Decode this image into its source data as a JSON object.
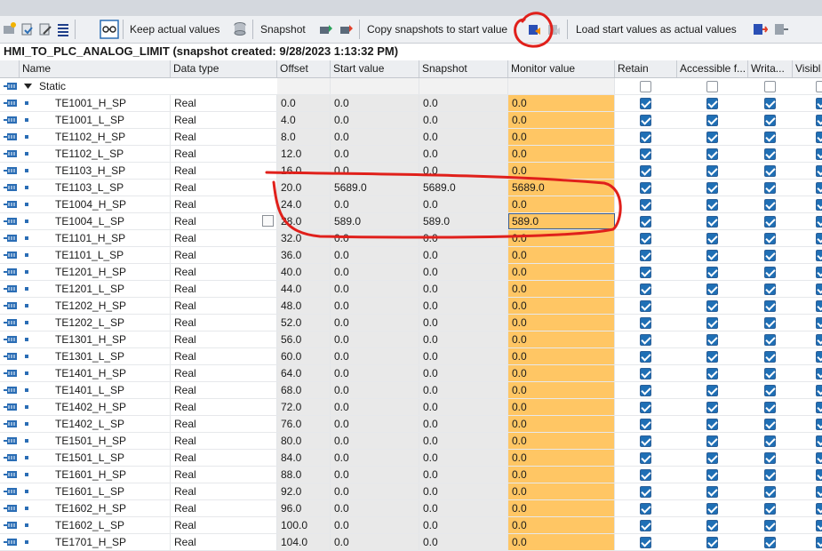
{
  "toolbar": {
    "keep_actual_values": "Keep actual values",
    "snapshot": "Snapshot",
    "copy_snapshots": "Copy snapshots to start value",
    "load_start_values": "Load start values as actual values"
  },
  "block": {
    "title": "HMI_TO_PLC_ANALOG_LIMIT (snapshot created: 9/28/2023 1:13:32 PM)"
  },
  "columns": {
    "name": "Name",
    "data_type": "Data type",
    "offset": "Offset",
    "start_value": "Start value",
    "snapshot": "Snapshot",
    "monitor_value": "Monitor value",
    "retain": "Retain",
    "accessible": "Accessible f...",
    "writable": "Writa...",
    "visible": "Visibl"
  },
  "static_label": "Static",
  "rows": [
    {
      "name": "TE1001_H_SP",
      "type": "Real",
      "offset": "0.0",
      "start": "0.0",
      "snapshot": "0.0",
      "monitor": "0.0"
    },
    {
      "name": "TE1001_L_SP",
      "type": "Real",
      "offset": "4.0",
      "start": "0.0",
      "snapshot": "0.0",
      "monitor": "0.0"
    },
    {
      "name": "TE1102_H_SP",
      "type": "Real",
      "offset": "8.0",
      "start": "0.0",
      "snapshot": "0.0",
      "monitor": "0.0"
    },
    {
      "name": "TE1102_L_SP",
      "type": "Real",
      "offset": "12.0",
      "start": "0.0",
      "snapshot": "0.0",
      "monitor": "0.0"
    },
    {
      "name": "TE1103_H_SP",
      "type": "Real",
      "offset": "16.0",
      "start": "0.0",
      "snapshot": "0.0",
      "monitor": "0.0"
    },
    {
      "name": "TE1103_L_SP",
      "type": "Real",
      "offset": "20.0",
      "start": "5689.0",
      "snapshot": "5689.0",
      "monitor": "5689.0"
    },
    {
      "name": "TE1004_H_SP",
      "type": "Real",
      "offset": "24.0",
      "start": "0.0",
      "snapshot": "0.0",
      "monitor": "0.0"
    },
    {
      "name": "TE1004_L_SP",
      "type": "Real",
      "offset": "28.0",
      "start": "589.0",
      "snapshot": "589.0",
      "monitor": "589.0"
    },
    {
      "name": "TE1101_H_SP",
      "type": "Real",
      "offset": "32.0",
      "start": "0.0",
      "snapshot": "0.0",
      "monitor": "0.0"
    },
    {
      "name": "TE1101_L_SP",
      "type": "Real",
      "offset": "36.0",
      "start": "0.0",
      "snapshot": "0.0",
      "monitor": "0.0"
    },
    {
      "name": "TE1201_H_SP",
      "type": "Real",
      "offset": "40.0",
      "start": "0.0",
      "snapshot": "0.0",
      "monitor": "0.0"
    },
    {
      "name": "TE1201_L_SP",
      "type": "Real",
      "offset": "44.0",
      "start": "0.0",
      "snapshot": "0.0",
      "monitor": "0.0"
    },
    {
      "name": "TE1202_H_SP",
      "type": "Real",
      "offset": "48.0",
      "start": "0.0",
      "snapshot": "0.0",
      "monitor": "0.0"
    },
    {
      "name": "TE1202_L_SP",
      "type": "Real",
      "offset": "52.0",
      "start": "0.0",
      "snapshot": "0.0",
      "monitor": "0.0"
    },
    {
      "name": "TE1301_H_SP",
      "type": "Real",
      "offset": "56.0",
      "start": "0.0",
      "snapshot": "0.0",
      "monitor": "0.0"
    },
    {
      "name": "TE1301_L_SP",
      "type": "Real",
      "offset": "60.0",
      "start": "0.0",
      "snapshot": "0.0",
      "monitor": "0.0"
    },
    {
      "name": "TE1401_H_SP",
      "type": "Real",
      "offset": "64.0",
      "start": "0.0",
      "snapshot": "0.0",
      "monitor": "0.0"
    },
    {
      "name": "TE1401_L_SP",
      "type": "Real",
      "offset": "68.0",
      "start": "0.0",
      "snapshot": "0.0",
      "monitor": "0.0"
    },
    {
      "name": "TE1402_H_SP",
      "type": "Real",
      "offset": "72.0",
      "start": "0.0",
      "snapshot": "0.0",
      "monitor": "0.0"
    },
    {
      "name": "TE1402_L_SP",
      "type": "Real",
      "offset": "76.0",
      "start": "0.0",
      "snapshot": "0.0",
      "monitor": "0.0"
    },
    {
      "name": "TE1501_H_SP",
      "type": "Real",
      "offset": "80.0",
      "start": "0.0",
      "snapshot": "0.0",
      "monitor": "0.0"
    },
    {
      "name": "TE1501_L_SP",
      "type": "Real",
      "offset": "84.0",
      "start": "0.0",
      "snapshot": "0.0",
      "monitor": "0.0"
    },
    {
      "name": "TE1601_H_SP",
      "type": "Real",
      "offset": "88.0",
      "start": "0.0",
      "snapshot": "0.0",
      "monitor": "0.0"
    },
    {
      "name": "TE1601_L_SP",
      "type": "Real",
      "offset": "92.0",
      "start": "0.0",
      "snapshot": "0.0",
      "monitor": "0.0"
    },
    {
      "name": "TE1602_H_SP",
      "type": "Real",
      "offset": "96.0",
      "start": "0.0",
      "snapshot": "0.0",
      "monitor": "0.0"
    },
    {
      "name": "TE1602_L_SP",
      "type": "Real",
      "offset": "100.0",
      "start": "0.0",
      "snapshot": "0.0",
      "monitor": "0.0"
    },
    {
      "name": "TE1701_H_SP",
      "type": "Real",
      "offset": "104.0",
      "start": "0.0",
      "snapshot": "0.0",
      "monitor": "0.0"
    }
  ],
  "colors": {
    "monitor_bg": "#ffc664",
    "snapshot_bg": "#e9e9e9",
    "checkbox_blue": "#1f6fb5",
    "annotation_red": "#e0201b"
  },
  "icons": {
    "row_icon": "db-tag-icon",
    "expand": "triangle-down-icon"
  }
}
